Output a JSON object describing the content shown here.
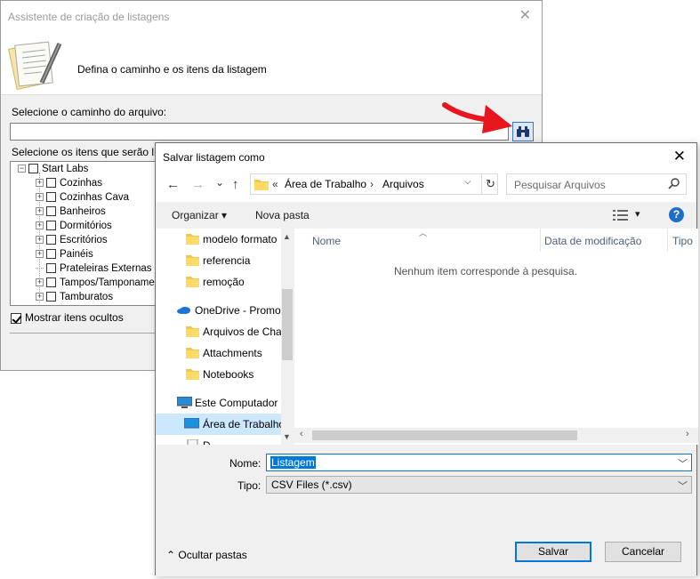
{
  "wizard": {
    "title": "Assistente de criação de listagens",
    "close_glyph": "✕",
    "header_text": "Defina o caminho e os itens da listagem",
    "header_icon": "document-pen-icon",
    "path_label": "Selecione o caminho do arquivo:",
    "path_value": "",
    "browse_icon": "binoculars-icon",
    "items_label": "Selecione os itens que serão listados",
    "tree": {
      "root": "Start Labs",
      "children": [
        {
          "label": "Cozinhas",
          "expandable": true
        },
        {
          "label": "Cozinhas Cava",
          "expandable": true
        },
        {
          "label": "Banheiros",
          "expandable": true
        },
        {
          "label": "Dormitórios",
          "expandable": true
        },
        {
          "label": "Escritórios",
          "expandable": true
        },
        {
          "label": "Painéis",
          "expandable": true
        },
        {
          "label": "Prateleiras Externas",
          "expandable": false
        },
        {
          "label": "Tampos/Tamponamentos",
          "expandable": true
        },
        {
          "label": "Tamburatos",
          "expandable": true
        }
      ]
    },
    "show_hidden_label": "Mostrar itens ocultos",
    "show_hidden_checked": true
  },
  "annotation": {
    "arrow_color": "#e8141e"
  },
  "save_dialog": {
    "title": "Salvar listagem como",
    "close_glyph": "✕",
    "nav": {
      "back": "←",
      "forward": "→",
      "recent": "⌄",
      "up": "↑"
    },
    "address": {
      "prefix": "«",
      "crumbs": [
        "Área de Trabalho",
        "Arquivos"
      ],
      "separator": "›",
      "dropdown": "⌵",
      "refresh": "↻"
    },
    "search_placeholder": "Pesquisar Arquivos",
    "toolbar": {
      "organize": "Organizar ▾",
      "new_folder": "Nova pasta",
      "view_drop": "▾"
    },
    "nav_pane": [
      {
        "label": "modelo formato",
        "icon": "folder-icon",
        "selected": false
      },
      {
        "label": "referencia",
        "icon": "folder-icon",
        "selected": false
      },
      {
        "label": "remoção",
        "icon": "folder-icon",
        "selected": false
      },
      {
        "label": "OneDrive - Promo",
        "icon": "cloud-icon",
        "selected": false
      },
      {
        "label": "Arquivos de Cha",
        "icon": "folder-icon",
        "selected": false
      },
      {
        "label": "Attachments",
        "icon": "folder-icon",
        "selected": false
      },
      {
        "label": "Notebooks",
        "icon": "folder-icon",
        "selected": false
      },
      {
        "label": "Este Computador",
        "icon": "computer-icon",
        "selected": false
      },
      {
        "label": "Área de Trabalho",
        "icon": "desktop-icon",
        "selected": true
      },
      {
        "label": "D",
        "icon": "document-icon",
        "selected": false
      }
    ],
    "columns": [
      "Nome",
      "Data de modificação",
      "Tipo"
    ],
    "empty_message": "Nenhum item corresponde à pesquisa.",
    "name_label": "Nome:",
    "name_value": "Listagem",
    "type_label": "Tipo:",
    "type_value": "CSV Files (*.csv)",
    "hide_folders": "⌃  Ocultar pastas",
    "save_button": "Salvar",
    "cancel_button": "Cancelar"
  }
}
